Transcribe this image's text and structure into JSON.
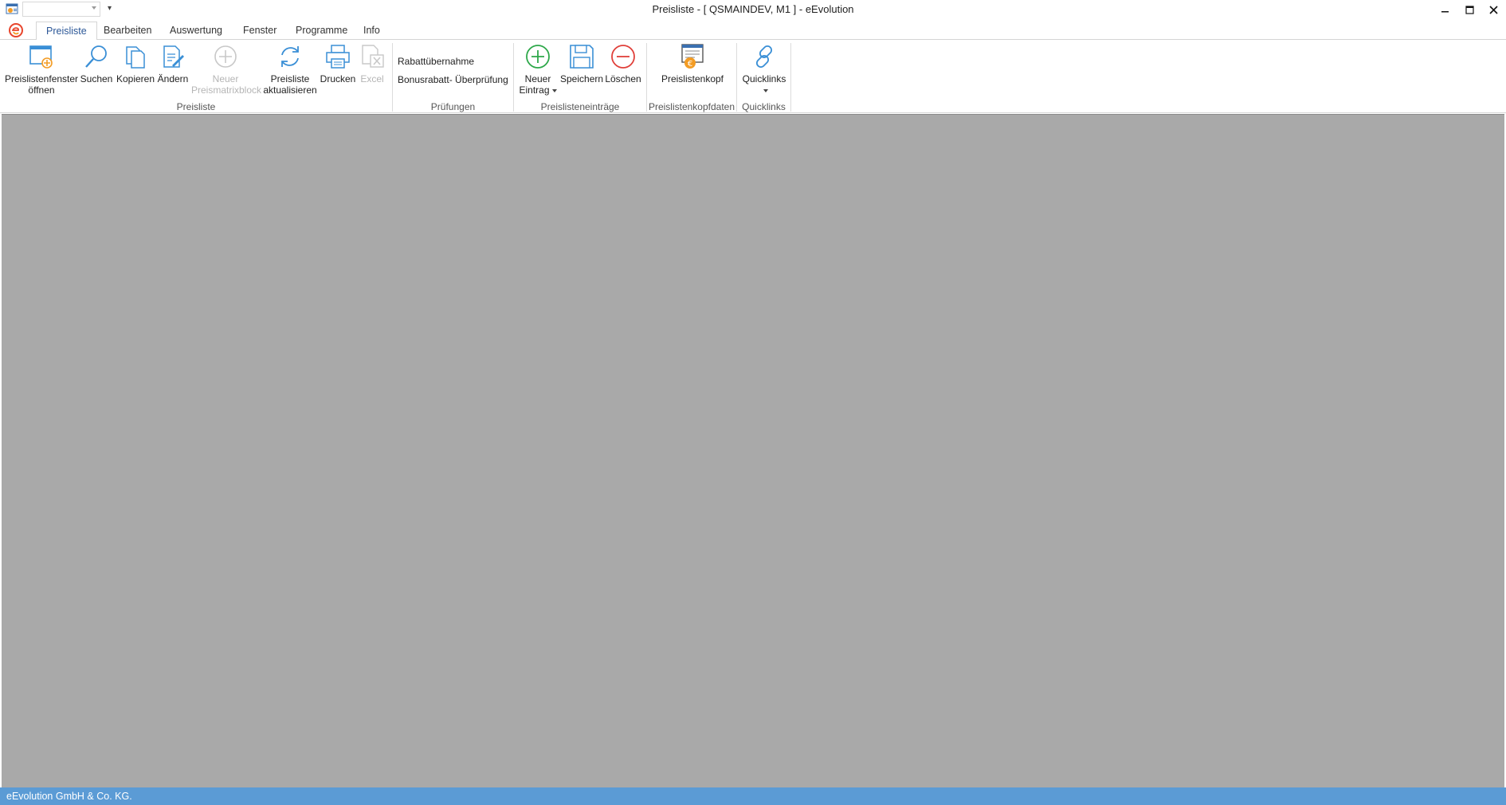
{
  "window": {
    "title": "Preisliste - [ QSMAINDEV, M1 ]  -  eEvolution"
  },
  "quick_access": {
    "combo_value": "",
    "customize_icon": "qat-customize-icon"
  },
  "tabs": [
    {
      "label": "Preisliste",
      "active": true
    },
    {
      "label": "Bearbeiten",
      "active": false
    },
    {
      "label": "Auswertung",
      "active": false
    },
    {
      "label": "Fenster",
      "active": false
    },
    {
      "label": "Programme",
      "active": false
    },
    {
      "label": "Info",
      "active": false
    }
  ],
  "ribbon": {
    "groups": {
      "preisliste": "Preisliste",
      "pruefungen": "Prüfungen",
      "eintraege": "Preislisteneinträge",
      "kopfdaten": "Preislistenkopfdaten",
      "quicklinks": "Quicklinks"
    },
    "buttons": {
      "open_window_1": "Preislistenfenster",
      "open_window_2": "öffnen",
      "search": "Suchen",
      "copy": "Kopieren",
      "edit": "Ändern",
      "new_matrix_1": "Neuer",
      "new_matrix_2": "Preismatrixblock",
      "refresh_1": "Preisliste",
      "refresh_2": "aktualisieren",
      "print": "Drucken",
      "excel": "Excel",
      "rabatt": "Rabattübernahme",
      "bonus": "Bonusrabatt- Überprüfung",
      "new_entry_1": "Neuer",
      "new_entry_2": "Eintrag",
      "save": "Speichern",
      "delete": "Löschen",
      "header": "Preislistenkopf",
      "quicklinks": "Quicklinks"
    }
  },
  "status": {
    "text": "eEvolution GmbH & Co. KG."
  },
  "colors": {
    "accent": "#2b5797",
    "status_bar": "#5b9bd5",
    "workspace": "#a9a9a9",
    "green": "#2ea84a",
    "red": "#e0403a",
    "blue_icon": "#3a8fd6"
  }
}
